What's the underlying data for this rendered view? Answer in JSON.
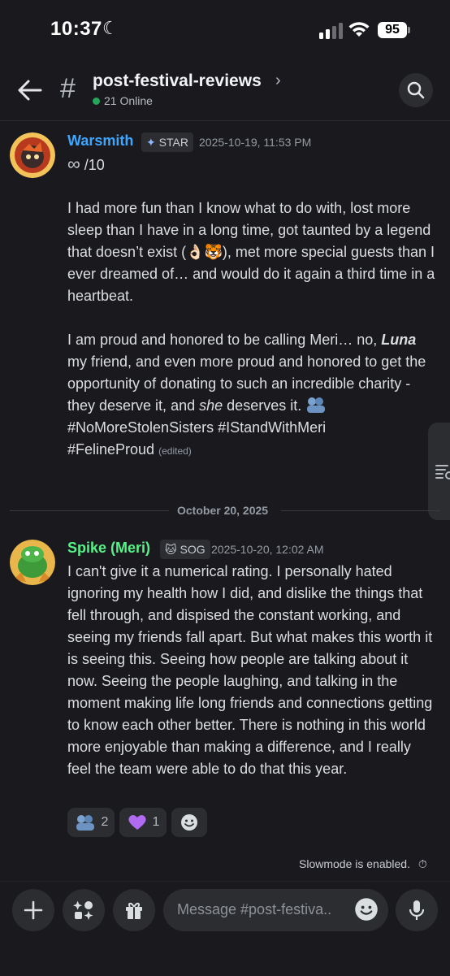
{
  "status_bar": {
    "time": "10:37",
    "battery": "95"
  },
  "header": {
    "channel_name": "post-festival-reviews",
    "online_count": "21 Online"
  },
  "messages": [
    {
      "username": "Warsmith",
      "role_tag": "STAR",
      "timestamp": "2025-10-19, 11:53 PM",
      "rating_suffix": "/10",
      "para1": "I had more fun than I know what to do with, lost more sleep than I have in a long time, got taunted by a legend that doesn’t exist (👌🏻🐯), met more special guests than I ever dreamed of… and would do it again a third time in a heartbeat.",
      "para2_a": "I am proud and honored to be calling Meri… no,",
      "para2_luna": "Luna",
      "para2_b": "my friend, and even more proud and honored to get the opportunity of donating to such an incredible charity - they deserve it, and",
      "para2_she": "she",
      "para2_c": "deserves it.",
      "hashtags_1": "#NoMoreStolenSisters #IStandWithMeri",
      "hashtags_2": "#FelineProud",
      "edited": "(edited)"
    },
    {
      "username": "Spike (Meri)",
      "role_tag": "SOG",
      "timestamp": "2025-10-20, 12:02 AM",
      "text": "I can't give it a numerical rating. I personally hated ignoring my health how I did, and dislike the things that fell through, and dispised the constant working, and seeing my friends fall apart. But what makes this worth it is seeing this. Seeing how people are talking about it now. Seeing the people laughing, and talking in the moment making life long friends and connections getting to know each other better. There is nothing in this world more enjoyable than making a difference, and I really feel the team were able to do that this year.",
      "reactions": [
        {
          "icon": "hug-emoji-icon",
          "count": "2"
        },
        {
          "icon": "purple-heart-icon",
          "count": "1"
        }
      ]
    }
  ],
  "date_divider": "October 20, 2025",
  "slowmode_text": "Slowmode is enabled.",
  "input": {
    "placeholder": "Message #post-festiva.."
  }
}
